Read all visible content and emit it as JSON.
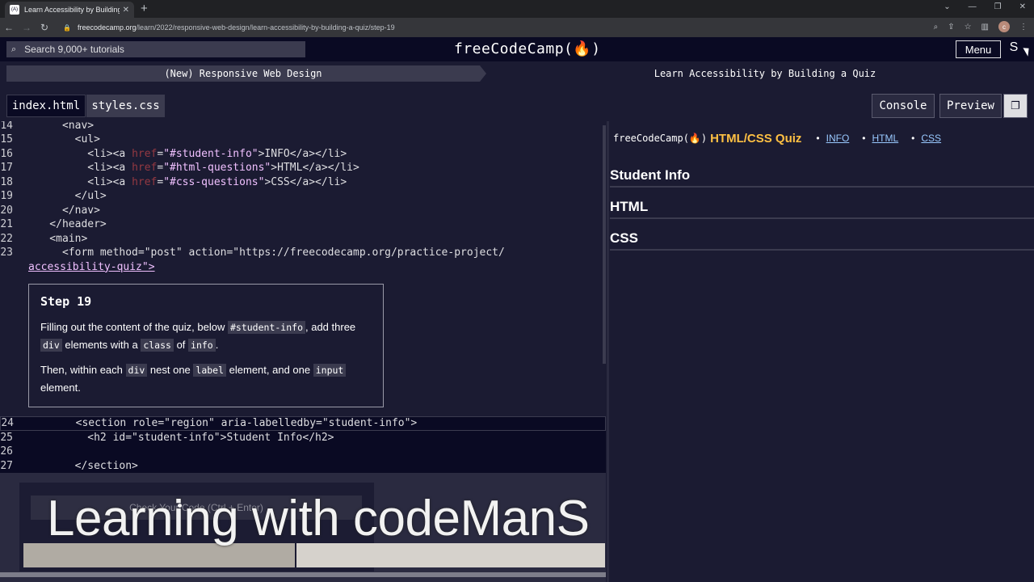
{
  "browser": {
    "tab_title": "Learn Accessibility by Building a ...",
    "tab_icon": "(A)",
    "url_host": "freecodecamp.org",
    "url_path": "/learn/2022/responsive-web-design/learn-accessibility-by-building-a-quiz/step-19",
    "profile_initial": "c"
  },
  "nav": {
    "search_placeholder": "Search 9,000+ tutorials",
    "brand": "freeCodeCamp(🔥)",
    "menu_label": "Menu",
    "sign_icon": "S"
  },
  "breadcrumb": {
    "superblock": "(New) Responsive Web Design",
    "block": "Learn Accessibility by Building a Quiz"
  },
  "editor_tabs": {
    "html": "index.html",
    "css": "styles.css"
  },
  "panel_buttons": {
    "console": "Console",
    "preview": "Preview"
  },
  "code_upper": [
    {
      "n": "14",
      "text": "      <nav>"
    },
    {
      "n": "15",
      "text": "        <ul>"
    },
    {
      "n": "16",
      "pre": "          <li><a ",
      "attr": "href",
      "eq": "=",
      "val": "\"#student-info\"",
      "post": ">INFO</a></li>"
    },
    {
      "n": "17",
      "pre": "          <li><a ",
      "attr": "href",
      "eq": "=",
      "val": "\"#html-questions\"",
      "post": ">HTML</a></li>"
    },
    {
      "n": "18",
      "pre": "          <li><a ",
      "attr": "href",
      "eq": "=",
      "val": "\"#css-questions\"",
      "post": ">CSS</a></li>"
    },
    {
      "n": "19",
      "text": "        </ul>"
    },
    {
      "n": "20",
      "text": "      </nav>"
    },
    {
      "n": "21",
      "text": "    </header>"
    },
    {
      "n": "22",
      "text": "    <main>"
    },
    {
      "n": "23",
      "text": "      <form method=\"post\" action=\"https://freecodecamp.org/practice-project/"
    },
    {
      "n": "",
      "text": "accessibility-quiz\">"
    }
  ],
  "step": {
    "title": "Step 19",
    "p1_a": "Filling out the content of the quiz, below ",
    "p1_code1": "#student-info",
    "p1_b": ", add three",
    "p1_code2": "div",
    "p1_c": " elements with a ",
    "p1_code3": "class",
    "p1_d": " of ",
    "p1_code4": "info",
    "p1_e": ".",
    "p2_a": "Then, within each ",
    "p2_code1": "div",
    "p2_b": " nest one ",
    "p2_code2": "label",
    "p2_c": " element, and one ",
    "p2_code3": "input",
    "p2_d": "element."
  },
  "code_lower": [
    {
      "n": "24",
      "text": "        <section role=\"region\" aria-labelledby=\"student-info\">"
    },
    {
      "n": "25",
      "text": "          <h2 id=\"student-info\">Student Info</h2>"
    },
    {
      "n": "26",
      "text": ""
    },
    {
      "n": "27",
      "text": "        </section>"
    }
  ],
  "check_button": "Check Your Code (Ctrl + Enter)",
  "watermark": "Learning with codeManS",
  "progress": {
    "fraction": 0.47
  },
  "preview": {
    "logo": "freeCodeCamp(🔥)",
    "title": "HTML/CSS Quiz",
    "links": [
      "INFO",
      "HTML",
      "CSS"
    ],
    "headings": [
      "Student Info",
      "HTML",
      "CSS"
    ]
  },
  "colors": {
    "bg": "#1b1b32",
    "nav_bg": "#0a0a23",
    "accent_yellow": "#fec043",
    "link_blue": "#99c9ff"
  }
}
